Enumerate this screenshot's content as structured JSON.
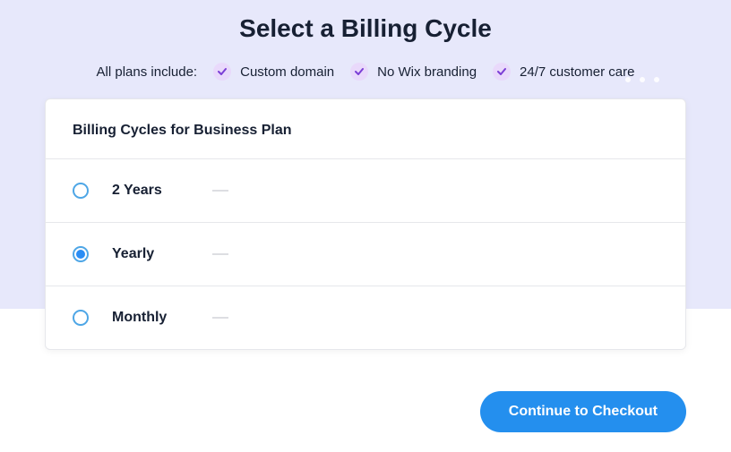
{
  "header": {
    "title": "Select a Billing Cycle",
    "features_intro": "All plans include:",
    "features": [
      {
        "label": "Custom domain"
      },
      {
        "label": "No Wix branding"
      },
      {
        "label": "24/7 customer care"
      }
    ]
  },
  "card": {
    "title": "Billing Cycles for Business Plan",
    "options": [
      {
        "label": "2 Years",
        "selected": false
      },
      {
        "label": "Yearly",
        "selected": true
      },
      {
        "label": "Monthly",
        "selected": false
      }
    ]
  },
  "cta": {
    "label": "Continue to Checkout"
  }
}
